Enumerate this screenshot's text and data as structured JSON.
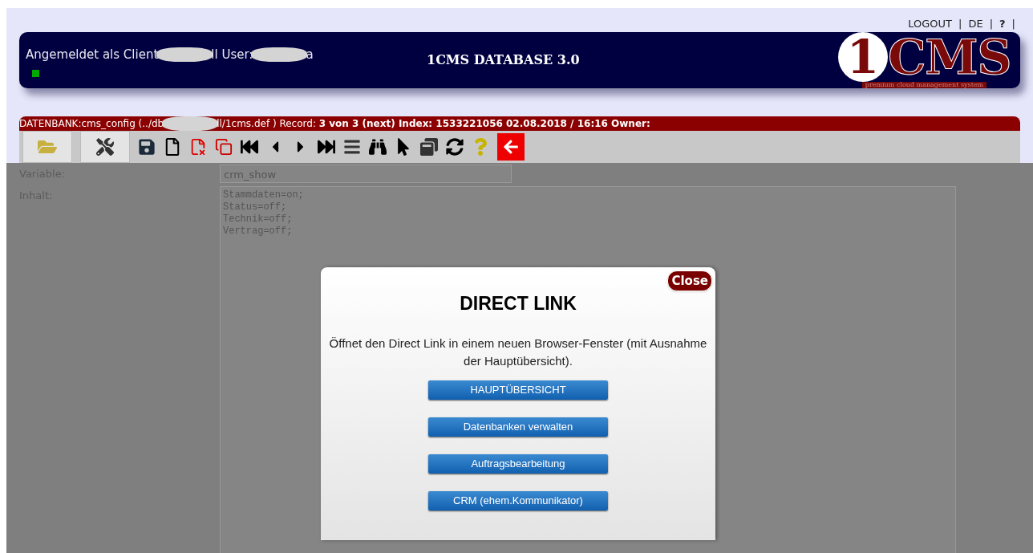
{
  "top_links": [
    {
      "label": "LOGOUT",
      "separator": "|"
    },
    {
      "label": "DE",
      "separator": "|"
    },
    {
      "label": "?",
      "separator": "|"
    }
  ],
  "header": {
    "login_text_1": "Angemeldet als Client",
    "login_text_2": "ll User:",
    "login_text_3": "a",
    "title": "1CMS DATABASE 3.0",
    "logo": {
      "number": "1",
      "letters": "CMS",
      "tagline": "premium cloud management system"
    }
  },
  "record_bar": {
    "text_1": "DATENBANK:cms_config (../db",
    "text_2": "ll/1cms.def ) Record: **3 von 3 (next) Index: 1533221056 02.08.2018 / 16:16 Owner:**"
  },
  "toolbar": {
    "tabs": [
      {
        "kind": "folder",
        "selected": false
      },
      {
        "kind": "tools",
        "selected": false
      }
    ],
    "tools": [
      {
        "kind": "save"
      },
      {
        "kind": "new"
      },
      {
        "kind": "delete"
      },
      {
        "kind": "copy"
      },
      {
        "kind": "first"
      },
      {
        "kind": "previous"
      },
      {
        "kind": "next"
      },
      {
        "kind": "last"
      },
      {
        "kind": "list"
      },
      {
        "kind": "search"
      },
      {
        "kind": "select"
      },
      {
        "kind": "windows"
      },
      {
        "kind": "refresh"
      },
      {
        "kind": "help"
      },
      {
        "kind": "back"
      }
    ]
  },
  "form": {
    "fields": [
      {
        "label": "Variable:",
        "kind": "input",
        "value": "crm_show"
      },
      {
        "label": "Inhalt:",
        "kind": "textarea",
        "value": "Stammdaten=on;\nStatus=off;\nTechnik=off;\nVertrag=off;"
      }
    ]
  },
  "dialog": {
    "close": "Close",
    "title": "DIRECT LINK",
    "text": "Öffnet den Direct Link in einem neuen Browser-Fenster (mit Ausnahme der Hauptübersicht).",
    "buttons": [
      "HAUPTÜBERSICHT",
      "Datenbanken verwalten",
      "Auftragsbearbeitung",
      "CRM (ehem.Kommunikator)"
    ]
  }
}
